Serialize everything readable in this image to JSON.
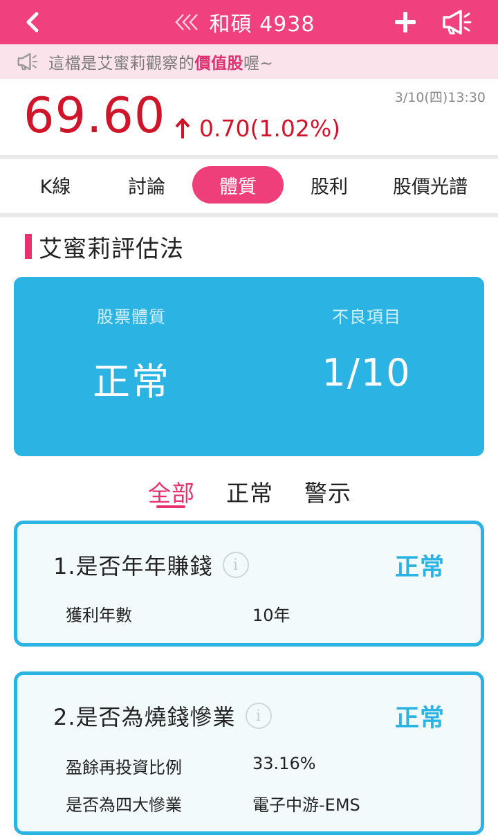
{
  "header": {
    "title": "和碩 4938"
  },
  "notice": {
    "prefix": "這檔是艾蜜莉觀察的",
    "highlight": "價值股",
    "suffix": "喔~"
  },
  "quote": {
    "price": "69.60",
    "change": "0.70(1.02%)",
    "timestamp": "3/10(四)13:30",
    "direction": "up",
    "color": "#d0152b"
  },
  "tabs": [
    {
      "label": "K線",
      "active": false
    },
    {
      "label": "討論",
      "active": false
    },
    {
      "label": "體質",
      "active": true
    },
    {
      "label": "股利",
      "active": false
    },
    {
      "label": "股價光譜",
      "active": false
    }
  ],
  "section": {
    "title": "艾蜜莉評估法"
  },
  "summary": {
    "left_label": "股票體質",
    "left_value": "正常",
    "right_label": "不良項目",
    "right_value": "1/10"
  },
  "filters": [
    {
      "label": "全部",
      "active": true
    },
    {
      "label": "正常",
      "active": false
    },
    {
      "label": "警示",
      "active": false
    }
  ],
  "cards": [
    {
      "title": "1.是否年年賺錢",
      "status": "正常",
      "rows": [
        {
          "key": "獲利年數",
          "value": "10年"
        }
      ]
    },
    {
      "title": "2.是否為燒錢慘業",
      "status": "正常",
      "rows": [
        {
          "key": "盈餘再投資比例",
          "value": "33.16%"
        },
        {
          "key": "是否為四大慘業",
          "value": "電子中游-EMS"
        }
      ]
    }
  ],
  "colors": {
    "brand": "#f0407e",
    "accent": "#2ab3e3",
    "price_up": "#d0152b"
  },
  "icons": {
    "back": "chevron-left-icon",
    "title_prefix": "double-chevron-left-icon",
    "add": "plus-icon",
    "announce": "megaphone-icon",
    "info": "info-icon",
    "arrow": "arrow-up-icon"
  }
}
